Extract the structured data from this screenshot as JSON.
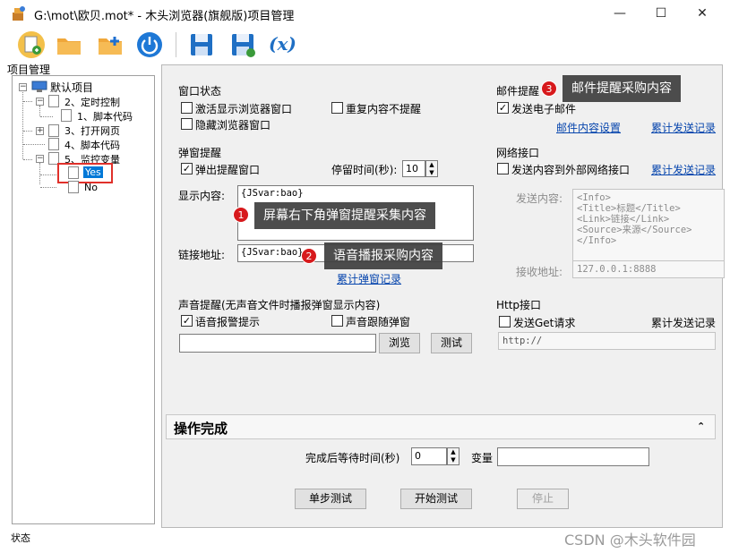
{
  "window": {
    "title": "G:\\mot\\欧贝.mot* - 木头浏览器(旗舰版)项目管理",
    "minimize": "—",
    "maximize": "☐",
    "close": "✕"
  },
  "toolbar": {
    "items": [
      "new-icon",
      "open-folder-icon",
      "add-folder-icon",
      "power-icon",
      "save-icon",
      "save-as-icon",
      "variable-icon"
    ],
    "variable_label": "(x)"
  },
  "tree": {
    "title": "项目管理",
    "root": "默认项目",
    "items": [
      "2、定时控制",
      "1、脚本代码",
      "3、打开网页",
      "4、脚本代码",
      "5、监控变量",
      "Yes",
      "No"
    ],
    "expand_minus": "−",
    "expand_plus": "+"
  },
  "window_state": {
    "title": "窗口状态",
    "activate": "激活显示浏览器窗口",
    "no_repeat": "重复内容不提醒",
    "hide": "隐藏浏览器窗口"
  },
  "popup": {
    "title": "弹窗提醒",
    "popup_window": "弹出提醒窗口",
    "popup_checked": "✓",
    "stay_label": "停留时间(秒):",
    "stay_value": "10",
    "content_label": "显示内容:",
    "content_value": "{JSvar:bao}",
    "link_label": "链接地址:",
    "link_value": "{JSvar:bao}",
    "stats_link": "累计弹窗记录"
  },
  "mail": {
    "title": "邮件提醒",
    "send": "发送电子邮件",
    "send_checked": "✓",
    "settings_link": "邮件内容设置",
    "stats_link": "累计发送记录"
  },
  "network": {
    "title": "网络接口",
    "send": "发送内容到外部网络接口",
    "stats_link": "累计发送记录",
    "content_label": "发送内容:",
    "content_lines": [
      "<Info>",
      "<Title>标题</Title>",
      "<Link>链接</Link>",
      "<Source>来源</Source>",
      "</Info>"
    ],
    "recv_label": "接收地址:",
    "recv_value": "127.0.0.1:8888"
  },
  "sound": {
    "title": "声音提醒(无声音文件时播报弹窗显示内容)",
    "voice": "语音报警提示",
    "voice_checked": "✓",
    "follow": "声音跟随弹窗",
    "browse": "浏览",
    "test": "测试"
  },
  "http": {
    "title": "Http接口",
    "send_get": "发送Get请求",
    "stats": "累计发送记录",
    "url_value": "http://"
  },
  "complete": {
    "title": "操作完成",
    "collapse_icon": "⌃",
    "wait_label": "完成后等待时间(秒)",
    "wait_value": "0",
    "var_label": "变量",
    "var_value": ""
  },
  "buttons": {
    "step_test": "单步测试",
    "start_test": "开始测试",
    "stop": "停止"
  },
  "annotations": [
    {
      "num": "1",
      "text": "屏幕右下角弹窗提醒采集内容"
    },
    {
      "num": "2",
      "text": "语音播报采购内容"
    },
    {
      "num": "3",
      "text": "邮件提醒采购内容"
    }
  ],
  "status": "状态",
  "watermark": "CSDN @木头软件园",
  "colors": {
    "accent": "#0645ad",
    "badge": "#d7191c",
    "selected": "#0078d7",
    "highlight_box": "#e0302a"
  }
}
